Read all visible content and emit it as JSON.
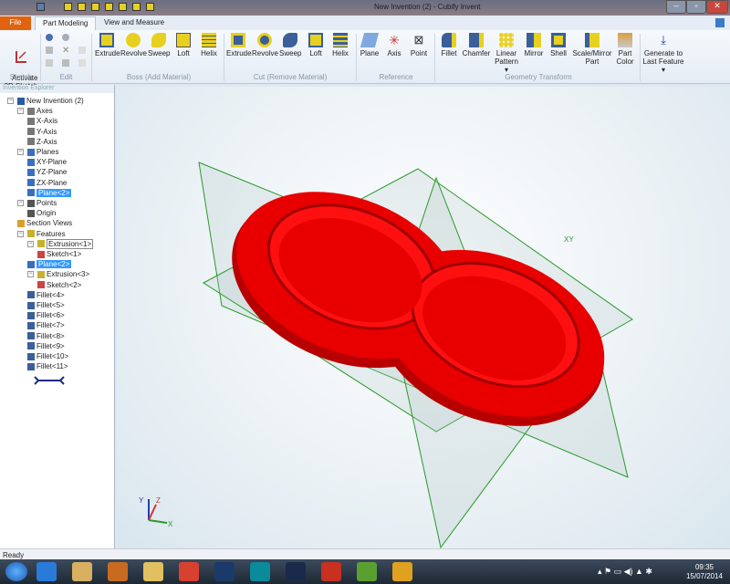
{
  "window": {
    "title": "New Invention (2) - Cubify Invent"
  },
  "tabs": {
    "file": "File",
    "part_modeling": "Part Modeling",
    "view_measure": "View and Measure"
  },
  "ribbon": {
    "sketch": {
      "button": "Activate\n2D Sketch",
      "label": "Sketch"
    },
    "edit": {
      "label": "Edit"
    },
    "boss": {
      "label": "Boss (Add Material)",
      "buttons": [
        "Extrude",
        "Revolve",
        "Sweep",
        "Loft",
        "Helix"
      ]
    },
    "cut": {
      "label": "Cut (Remove Material)",
      "buttons": [
        "Extrude",
        "Revolve",
        "Sweep",
        "Loft",
        "Helix"
      ]
    },
    "reference": {
      "label": "Reference",
      "buttons": [
        "Plane",
        "Axis",
        "Point"
      ]
    },
    "geometry": {
      "label": "Geometry Transform",
      "buttons": [
        "Fillet",
        "Chamfer",
        "Linear Pattern ▾",
        "Mirror",
        "Shell",
        "Scale/Mirror Part",
        "Part Color"
      ]
    },
    "generate": {
      "button": "Generate to Last Feature ▾"
    }
  },
  "explorer": {
    "title": "Invention Explorer",
    "items": [
      {
        "label": "New Invention (2)",
        "level": 0,
        "icon": "part"
      },
      {
        "label": "Axes",
        "level": 1,
        "icon": "axis"
      },
      {
        "label": "X-Axis",
        "level": 2,
        "icon": "axis"
      },
      {
        "label": "Y-Axis",
        "level": 2,
        "icon": "axis"
      },
      {
        "label": "Z-Axis",
        "level": 2,
        "icon": "axis"
      },
      {
        "label": "Planes",
        "level": 1,
        "icon": "plane"
      },
      {
        "label": "XY-Plane",
        "level": 2,
        "icon": "plane"
      },
      {
        "label": "YZ-Plane",
        "level": 2,
        "icon": "plane"
      },
      {
        "label": "ZX-Plane",
        "level": 2,
        "icon": "plane"
      },
      {
        "label": "Plane<2>",
        "level": 2,
        "icon": "plane",
        "selected": true
      },
      {
        "label": "Points",
        "level": 1,
        "icon": "point"
      },
      {
        "label": "Origin",
        "level": 2,
        "icon": "point"
      },
      {
        "label": "Section Views",
        "level": 1,
        "icon": "section"
      },
      {
        "label": "Features",
        "level": 1,
        "icon": "feature"
      },
      {
        "label": "Extrusion<1>",
        "level": 2,
        "icon": "feature",
        "boxed": true
      },
      {
        "label": "Sketch<1>",
        "level": 3,
        "icon": "sketch"
      },
      {
        "label": "Plane<2>",
        "level": 2,
        "icon": "plane",
        "selected": true
      },
      {
        "label": "Extrusion<3>",
        "level": 2,
        "icon": "feature"
      },
      {
        "label": "Sketch<2>",
        "level": 3,
        "icon": "sketch"
      },
      {
        "label": "Fillet<4>",
        "level": 2,
        "icon": "fillet"
      },
      {
        "label": "Fillet<5>",
        "level": 2,
        "icon": "fillet"
      },
      {
        "label": "Fillet<6>",
        "level": 2,
        "icon": "fillet"
      },
      {
        "label": "Fillet<7>",
        "level": 2,
        "icon": "fillet"
      },
      {
        "label": "Fillet<8>",
        "level": 2,
        "icon": "fillet"
      },
      {
        "label": "Fillet<9>",
        "level": 2,
        "icon": "fillet"
      },
      {
        "label": "Fillet<10>",
        "level": 2,
        "icon": "fillet"
      },
      {
        "label": "Fillet<11>",
        "level": 2,
        "icon": "fillet"
      }
    ]
  },
  "viewport": {
    "plane_label": "XY",
    "axes": {
      "x": "X",
      "y": "Y",
      "z": "Z"
    }
  },
  "status": {
    "text": "Ready"
  },
  "taskbar": {
    "time": "09:35",
    "date": "15/07/2014",
    "apps": [
      "ie",
      "explorer",
      "media",
      "outlook",
      "chrome",
      "Ps",
      "arduino",
      "Lr",
      "R",
      "app",
      "cubify"
    ]
  },
  "colors": {
    "part": "#e00000",
    "plane": "#2a9a2a",
    "accent": "#e2630f"
  }
}
